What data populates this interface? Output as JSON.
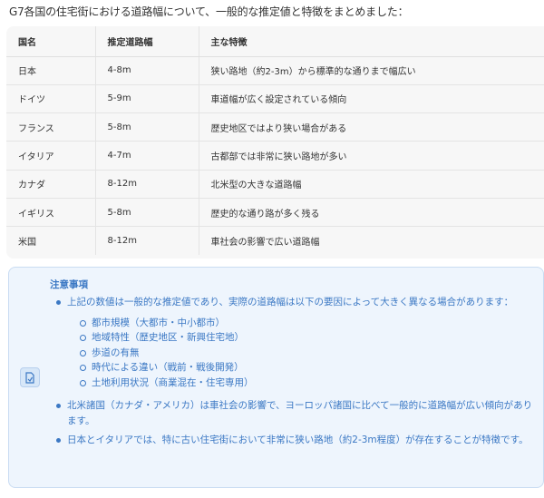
{
  "intro": "G7各国の住宅街における道路幅について、一般的な推定値と特徴をまとめました：",
  "table": {
    "headers": [
      "国名",
      "推定道路幅",
      "主な特徴"
    ],
    "rows": [
      [
        "日本",
        "4-8m",
        "狭い路地（約2-3m）から標準的な通りまで幅広い"
      ],
      [
        "ドイツ",
        "5-9m",
        "車道幅が広く設定されている傾向"
      ],
      [
        "フランス",
        "5-8m",
        "歴史地区ではより狭い場合がある"
      ],
      [
        "イタリア",
        "4-7m",
        "古都部では非常に狭い路地が多い"
      ],
      [
        "カナダ",
        "8-12m",
        "北米型の大きな道路幅"
      ],
      [
        "イギリス",
        "5-8m",
        "歴史的な通り路が多く残る"
      ],
      [
        "米国",
        "8-12m",
        "車社会の影響で広い道路幅"
      ]
    ]
  },
  "notice": {
    "icon": "document-icon",
    "title": "注意事項",
    "bullets": [
      "上記の数値は一般的な推定値であり、実際の道路幅は以下の要因によって大きく異なる場合があります：",
      "北米諸国（カナダ・アメリカ）は車社会の影響で、ヨーロッパ諸国に比べて一般的に道路幅が広い傾向があります。",
      "日本とイタリアでは、特に古い住宅街において非常に狭い路地（約2-3m程度）が存在することが特徴です。"
    ],
    "factors": [
      "都市規模（大都市・中小都市）",
      "地域特性（歴史地区・新興住宅地）",
      "歩道の有無",
      "時代による違い（戦前・戦後開発）",
      "土地利用状況（商業混在・住宅専用）"
    ],
    "accent": "#3b78c4",
    "background": "#eef5fd"
  }
}
